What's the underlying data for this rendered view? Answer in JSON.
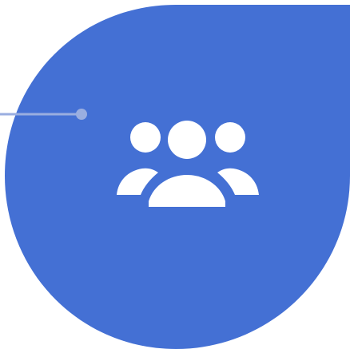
{
  "graphic": {
    "shape": "teardrop-with-sharp-top-right-corner",
    "icon": "users-group-icon"
  },
  "colors": {
    "teardrop": "#4470d4",
    "connector_line": "#9aaee0",
    "connector_dot": "#9aaee0",
    "icon": "#ffffff",
    "background": "#ffffff"
  }
}
